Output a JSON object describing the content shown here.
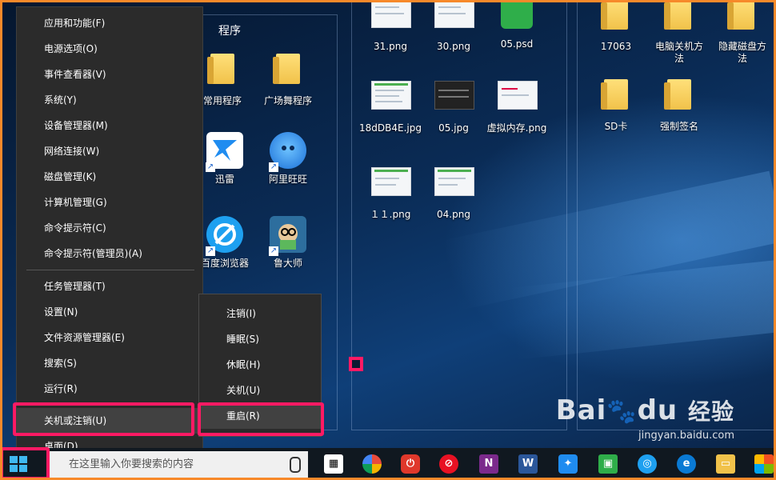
{
  "winx_menu": {
    "items": [
      {
        "label": "应用和功能(F)"
      },
      {
        "label": "电源选项(O)"
      },
      {
        "label": "事件查看器(V)"
      },
      {
        "label": "系统(Y)"
      },
      {
        "label": "设备管理器(M)"
      },
      {
        "label": "网络连接(W)"
      },
      {
        "label": "磁盘管理(K)"
      },
      {
        "label": "计算机管理(G)"
      },
      {
        "label": "命令提示符(C)"
      },
      {
        "label": "命令提示符(管理员)(A)"
      },
      {
        "label": "任务管理器(T)"
      },
      {
        "label": "设置(N)"
      },
      {
        "label": "文件资源管理器(E)"
      },
      {
        "label": "搜索(S)"
      },
      {
        "label": "运行(R)"
      },
      {
        "label": "关机或注销(U)"
      },
      {
        "label": "桌面(D)"
      }
    ]
  },
  "shutdown_submenu": {
    "items": [
      {
        "label": "注销(I)"
      },
      {
        "label": "睡眠(S)"
      },
      {
        "label": "休眠(H)"
      },
      {
        "label": "关机(U)"
      },
      {
        "label": "重启(R)"
      }
    ]
  },
  "desktop": {
    "group_title": "程序",
    "icons": {
      "common_programs": "常用程序",
      "square_dance": "广场舞程序",
      "xunlei": "迅雷",
      "aliwangwang": "阿里旺旺",
      "baidu_browser": "百度浏览器",
      "ludashi": "鲁大师",
      "png31": "31.png",
      "png30": "30.png",
      "psd05": "05.psd",
      "jpg18d": "18dDB4E.jpg",
      "jpg05": "05.jpg",
      "virtual_mem": "虚拟内存.png",
      "png11": "１１.png",
      "png04": "04.png",
      "folder17063": "17063",
      "folder_shutdown": "电脑关机方法",
      "folder_hidden": "隐藏磁盘方法",
      "folder_sd": "SD卡",
      "folder_force_sign": "强制签名"
    }
  },
  "taskbar": {
    "search_placeholder": "在这里输入你要搜索的内容"
  },
  "watermark": {
    "brand_left": "Bai",
    "brand_right": "du",
    "brand_cn": "经验",
    "url": "jingyan.baidu.com"
  }
}
